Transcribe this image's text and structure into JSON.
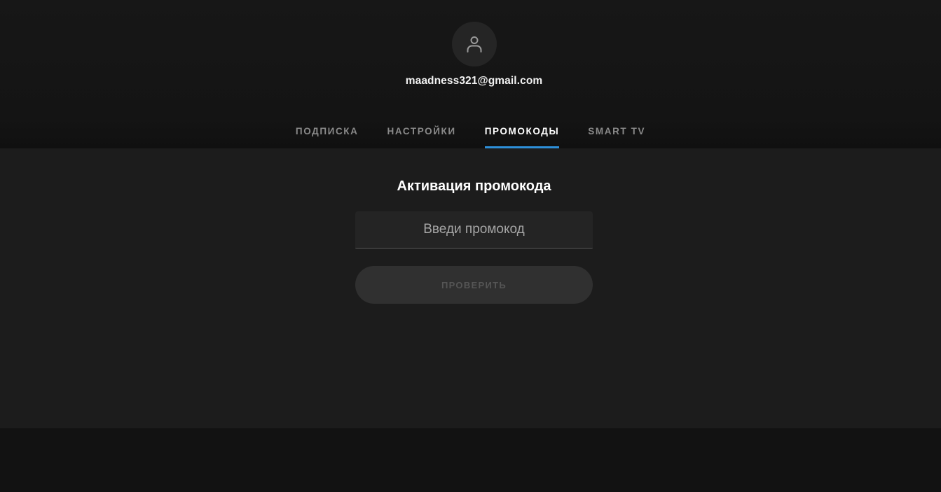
{
  "profile": {
    "avatar_icon": "user-icon",
    "email": "maadness321@gmail.com"
  },
  "tabs": [
    {
      "label": "ПОДПИСКА",
      "active": false
    },
    {
      "label": "НАСТРОЙКИ",
      "active": false
    },
    {
      "label": "ПРОМОКОДЫ",
      "active": true
    },
    {
      "label": "SMART TV",
      "active": false
    }
  ],
  "promo": {
    "title": "Активация промокода",
    "input_placeholder": "Введи промокод",
    "input_value": "",
    "button_label": "ПРОВЕРИТЬ",
    "button_disabled": true
  },
  "colors": {
    "accent": "#2d8fd8",
    "background": "#121212",
    "panel": "#1c1c1c"
  }
}
